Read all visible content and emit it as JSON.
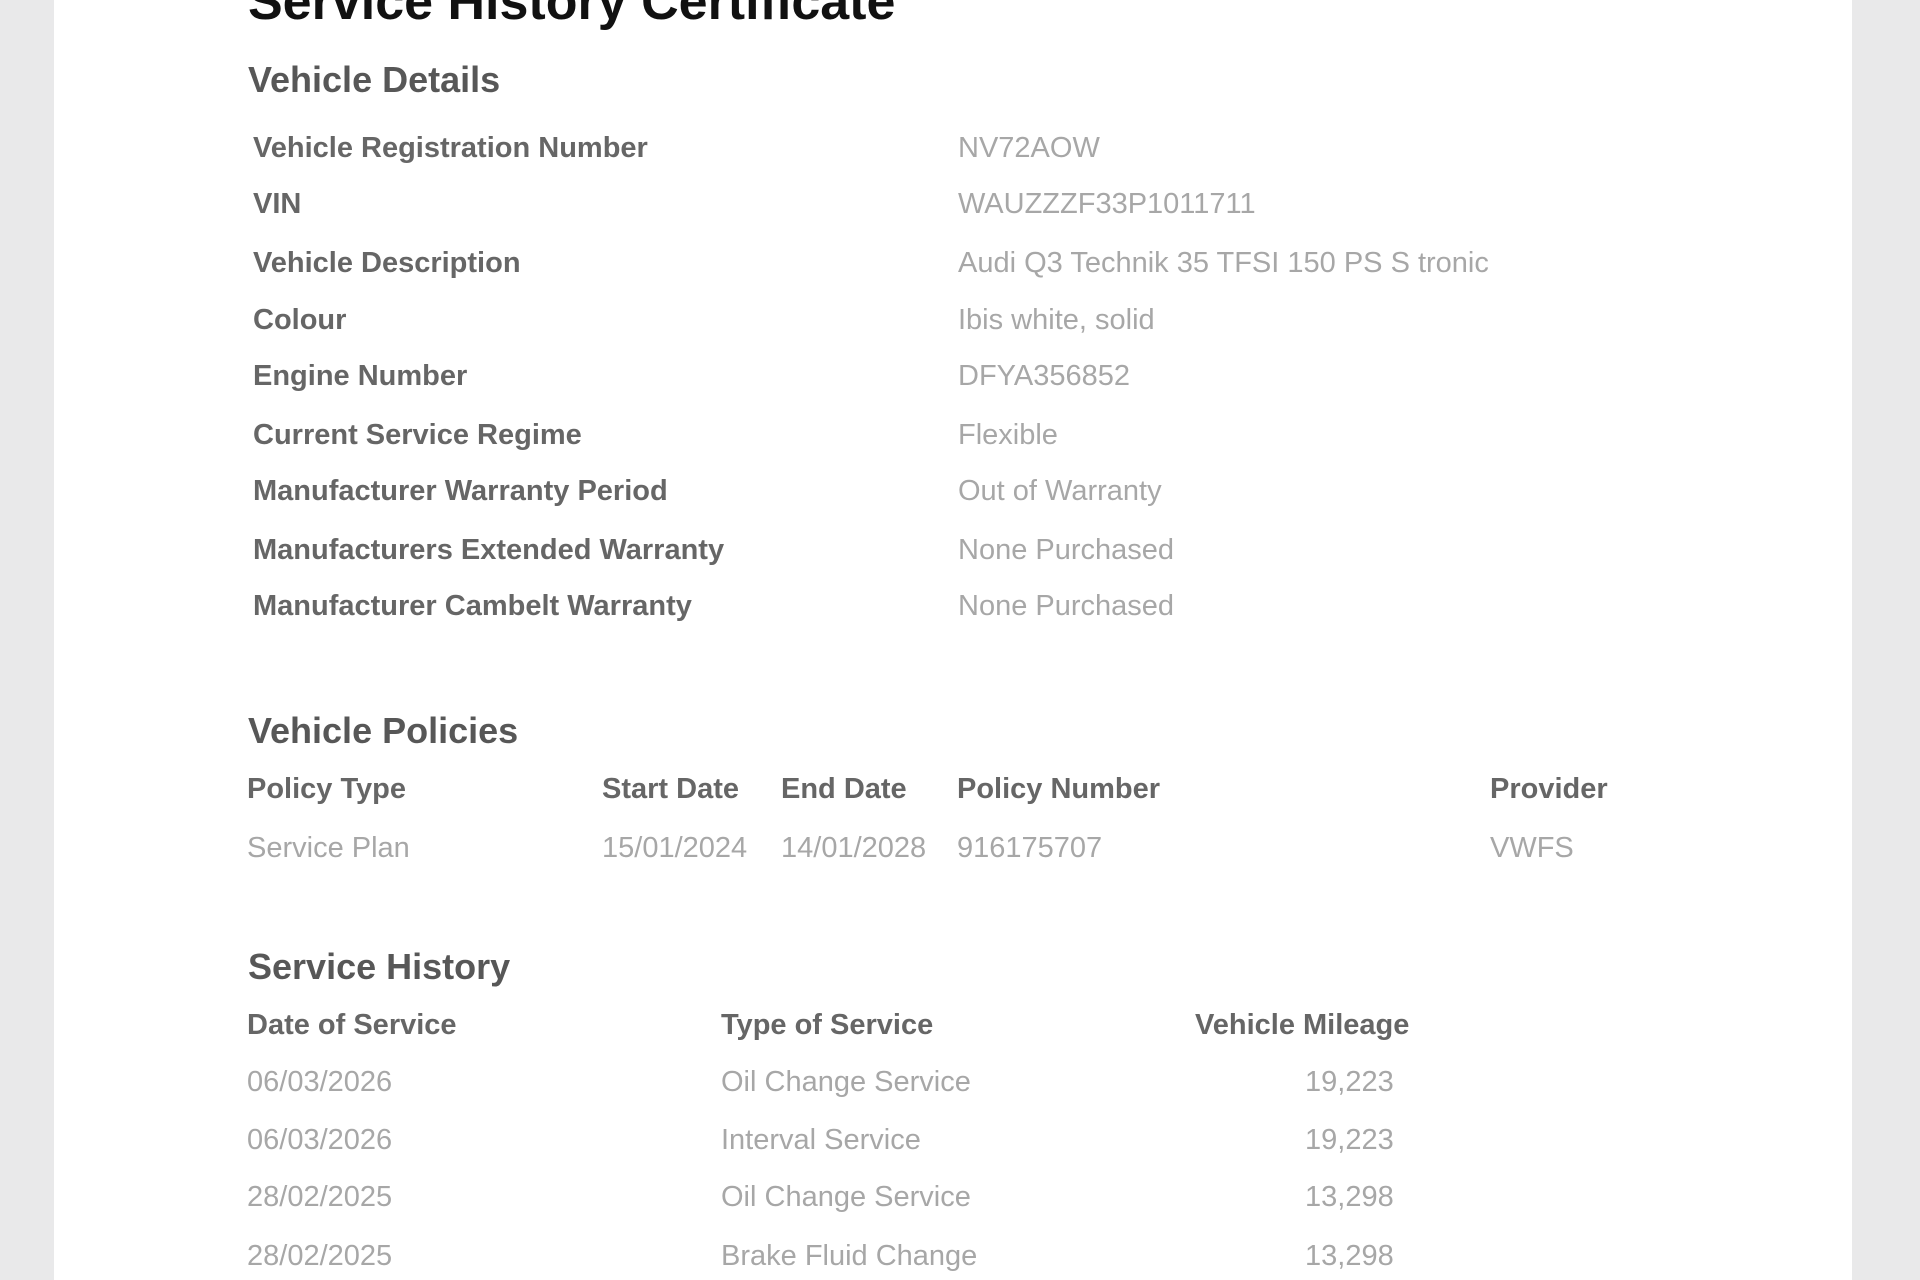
{
  "document": {
    "title": "Service History Certificate"
  },
  "vehicle_details": {
    "heading": "Vehicle Details",
    "rows": [
      {
        "label": "Vehicle Registration Number",
        "value": "NV72AOW"
      },
      {
        "label": "VIN",
        "value": "WAUZZZF33P1011711"
      },
      {
        "label": "Vehicle Description",
        "value": "Audi Q3  Technik 35 TFSI  150 PS S tronic"
      },
      {
        "label": "Colour",
        "value": "Ibis white, solid"
      },
      {
        "label": "Engine Number",
        "value": "DFYA356852"
      },
      {
        "label": "Current Service Regime",
        "value": "Flexible"
      },
      {
        "label": "Manufacturer Warranty Period",
        "value": "Out of Warranty"
      },
      {
        "label": "Manufacturers Extended Warranty",
        "value": "None Purchased"
      },
      {
        "label": "Manufacturer Cambelt Warranty",
        "value": "None Purchased"
      }
    ]
  },
  "vehicle_policies": {
    "heading": "Vehicle Policies",
    "columns": [
      "Policy Type",
      "Start Date",
      "End Date",
      "Policy Number",
      "Provider"
    ],
    "rows": [
      [
        "Service Plan",
        "15/01/2024",
        "14/01/2028",
        "916175707",
        "VWFS"
      ]
    ]
  },
  "service_history": {
    "heading": "Service History",
    "columns": [
      "Date of Service",
      "Type of Service",
      "Vehicle Mileage"
    ],
    "rows": [
      [
        "06/03/2026",
        "Oil Change Service",
        "19,223"
      ],
      [
        "06/03/2026",
        "Interval Service",
        "19,223"
      ],
      [
        "28/02/2025",
        "Oil Change Service",
        "13,298"
      ],
      [
        "28/02/2025",
        "Brake Fluid Change",
        "13,298"
      ]
    ]
  },
  "colors": {
    "page_background": "#e9e9ea",
    "paper": "#ffffff",
    "title_text": "#111111",
    "heading_text": "#575757",
    "label_text": "#666666",
    "value_text": "#a7a7a7"
  }
}
